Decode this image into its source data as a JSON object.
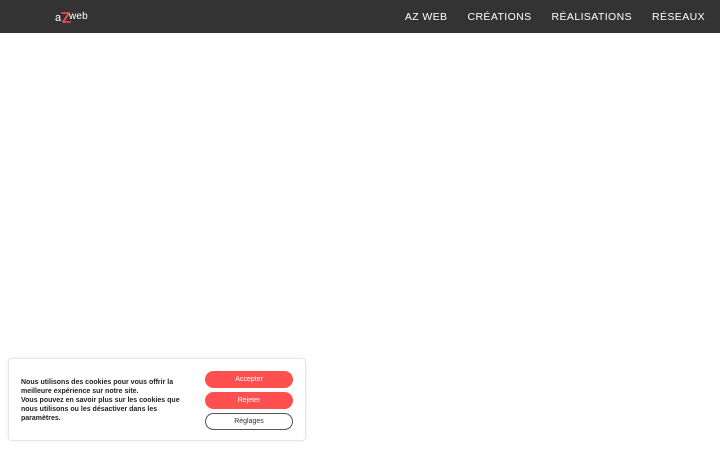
{
  "header": {
    "logo": {
      "text_left": "a",
      "text_right": "web",
      "mark_color": "#ff4f4f"
    },
    "nav": [
      {
        "label": "AZ WEB"
      },
      {
        "label": "CRÉATIONS"
      },
      {
        "label": "RÉALISATIONS"
      },
      {
        "label": "RÉSEAUX"
      }
    ],
    "background_color": "#333333"
  },
  "cookie_banner": {
    "message_lines": [
      "Nous utilisons des cookies pour vous offrir la meilleure expérience sur notre site.",
      "Vous pouvez en savoir plus sur les cookies que nous utilisons ou les désactiver dans les paramètres."
    ],
    "accept_label": "Accepter",
    "reject_label": "Rejeter",
    "settings_label": "Réglages",
    "accent_color": "#ff4f4f"
  }
}
